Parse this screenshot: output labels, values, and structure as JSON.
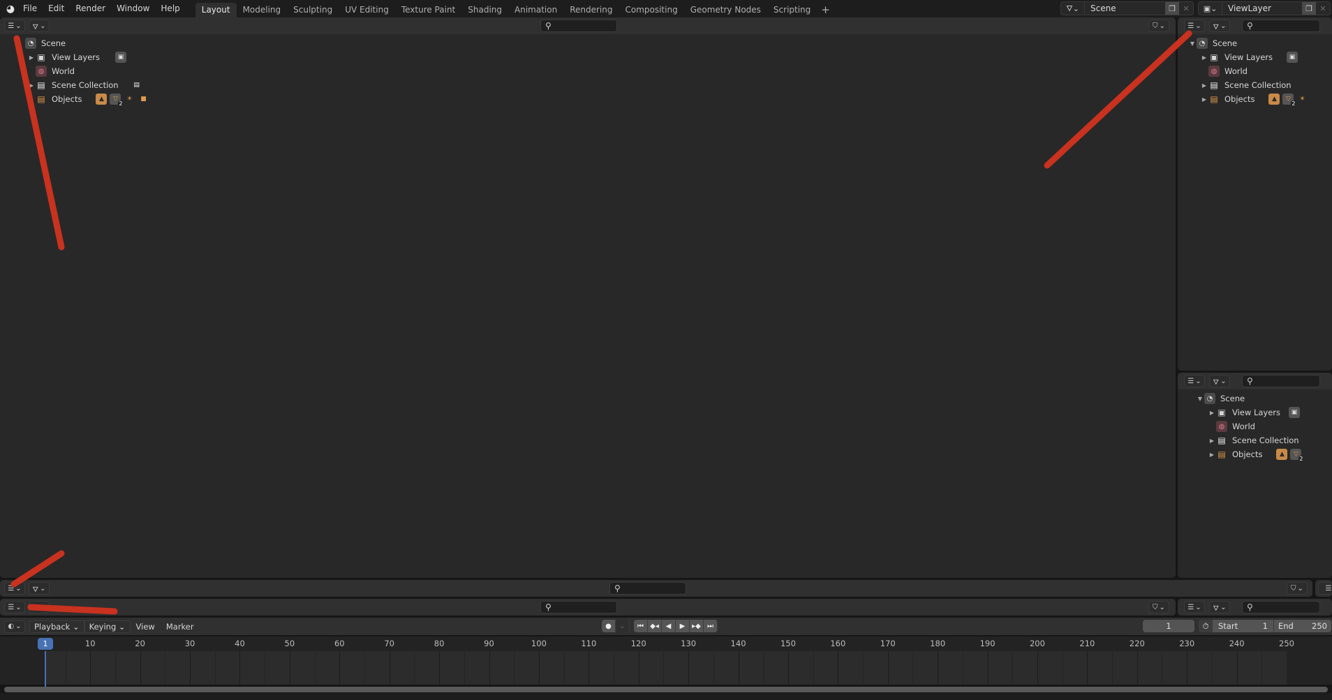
{
  "topbar": {
    "logo": "blender-logo",
    "menus": [
      "File",
      "Edit",
      "Render",
      "Window",
      "Help"
    ],
    "workspaces": [
      "Layout",
      "Modeling",
      "Sculpting",
      "UV Editing",
      "Texture Paint",
      "Shading",
      "Animation",
      "Rendering",
      "Compositing",
      "Geometry Nodes",
      "Scripting"
    ],
    "active_workspace": "Layout",
    "add_workspace": "+",
    "scene_selector": {
      "value": "Scene"
    },
    "viewlayer_selector": {
      "value": "ViewLayer"
    }
  },
  "icons": {
    "outliner": "☰",
    "chevron": "⌄",
    "display_mode": "◔",
    "search": "⚲",
    "filter": "⛉",
    "copy": "❐",
    "close": "✕"
  },
  "outliner_tree": {
    "scene": "Scene",
    "view_layers": "View Layers",
    "world": "World",
    "scene_collection": "Scene Collection",
    "objects": "Objects",
    "mesh_count": "2"
  },
  "timeline": {
    "menus": [
      "Playback",
      "Keying",
      "View",
      "Marker"
    ],
    "current_frame": "1",
    "start_label": "Start",
    "start_value": "1",
    "end_label": "End",
    "end_value": "250",
    "ruler_ticks": [
      "10",
      "20",
      "30",
      "40",
      "50",
      "60",
      "70",
      "80",
      "90",
      "100",
      "110",
      "120",
      "130",
      "140",
      "150",
      "160",
      "170",
      "180",
      "190",
      "200",
      "210",
      "220",
      "230",
      "240",
      "250"
    ],
    "playhead_frame": "1",
    "playback_buttons": [
      "jump-start",
      "prev-keyframe",
      "play-reverse",
      "play",
      "next-keyframe",
      "jump-end"
    ]
  }
}
